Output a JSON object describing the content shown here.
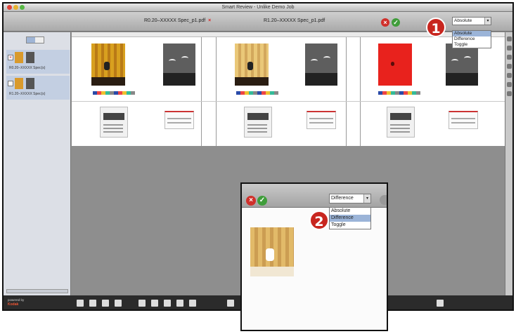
{
  "window": {
    "title": "Smart Review - Unlike Demo Job"
  },
  "documents": [
    {
      "filename": "R0.20–XXXXX Spec_p1.pdf",
      "close_icon": "x-icon"
    },
    {
      "filename": "R1.20–XXXXX Spec_p1.pdf"
    }
  ],
  "callouts": {
    "one": "1",
    "two": "2"
  },
  "blend": {
    "selected": "Absolute",
    "options": [
      "Absolute",
      "Difference",
      "Toggle"
    ],
    "inset_selected": "Difference",
    "inset_highlight": "Difference"
  },
  "sidebar": {
    "items": [
      {
        "filename": "R0.20–XXXXX Spec(s)",
        "checked": "×"
      },
      {
        "filename": "R1.20–XXXXX Spec(s)",
        "checked": ""
      }
    ]
  },
  "bottom": {
    "powered_line1": "powered by",
    "powered_line2": "Kodak"
  },
  "colors": {
    "reject": "#d0302b",
    "approve": "#3f9d3a",
    "callout": "#c8261f",
    "poster_red": "#e8221d"
  },
  "icons": [
    "reject-icon",
    "approve-icon",
    "chevron-down-icon",
    "grid-view-icon",
    "list-view-icon"
  ]
}
